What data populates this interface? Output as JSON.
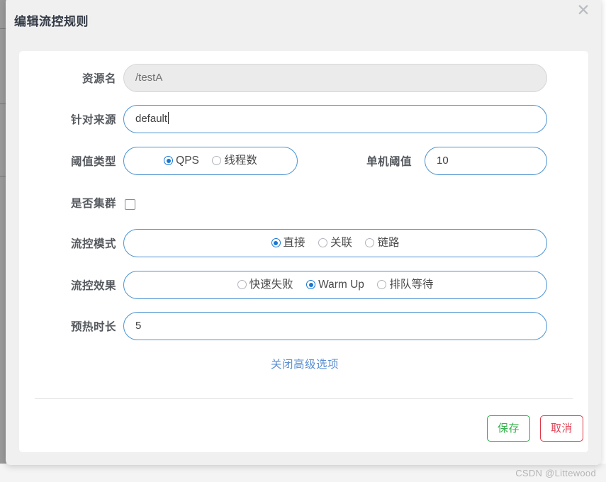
{
  "dialog": {
    "title": "编辑流控规则",
    "close_icon": "close-icon"
  },
  "form": {
    "rows": {
      "resource_name": {
        "label": "资源名",
        "value": "/testA",
        "disabled": true
      },
      "limit_origin": {
        "label": "针对来源",
        "value": "default",
        "has_caret": true
      },
      "threshold_type": {
        "label": "阈值类型",
        "options": [
          "QPS",
          "线程数"
        ],
        "selected": "QPS"
      },
      "single_threshold": {
        "label": "单机阈值",
        "value": "10"
      },
      "is_cluster": {
        "label": "是否集群",
        "checked": false
      },
      "flow_mode": {
        "label": "流控模式",
        "options": [
          "直接",
          "关联",
          "链路"
        ],
        "selected": "直接"
      },
      "flow_effect": {
        "label": "流控效果",
        "options": [
          "快速失败",
          "Warm Up",
          "排队等待"
        ],
        "selected": "Warm Up"
      },
      "warmup_period": {
        "label": "预热时长",
        "value": "5"
      }
    },
    "advanced_link": "关闭高级选项"
  },
  "footer": {
    "save_label": "保存",
    "cancel_label": "取消"
  },
  "watermark": "CSDN @Littewood",
  "colors": {
    "accent_blue": "#4b93d1",
    "radio_blue": "#1877d2",
    "link_blue": "#5a8fd0",
    "save_green": "#28a745",
    "cancel_red": "#dc3545",
    "dialog_bg": "#f0f0f0",
    "card_bg": "#ffffff"
  }
}
